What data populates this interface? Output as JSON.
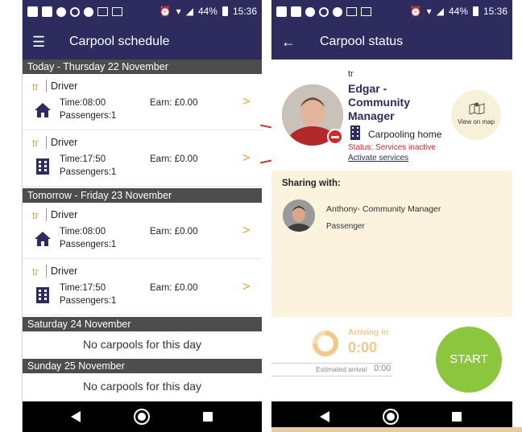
{
  "status_bar": {
    "battery": "44%",
    "time": "15:36"
  },
  "left": {
    "title": "Carpool schedule",
    "menu_icon": "menu-icon",
    "days": [
      {
        "label": "Today - Thursday 22 November"
      },
      {
        "label": "Tomorrow - Friday 23 November"
      },
      {
        "label": "Saturday 24 November"
      },
      {
        "label": "Sunday 25 November"
      }
    ],
    "trips": [
      {
        "tr": "tr",
        "role": "Driver",
        "time": "Time:08:00",
        "passengers": "Passengers:1",
        "earn": "Earn: £0.00",
        "icon": "home-icon"
      },
      {
        "tr": "tr",
        "role": "Driver",
        "time": "Time:17:50",
        "passengers": "Passengers:1",
        "earn": "Earn: £0.00",
        "icon": "building-icon"
      },
      {
        "tr": "tr",
        "role": "Driver",
        "time": "Time:08:00",
        "passengers": "Passengers:1",
        "earn": "Earn: £0.00",
        "icon": "home-icon"
      },
      {
        "tr": "tr",
        "role": "Driver",
        "time": "Time:17:50",
        "passengers": "Passengers:1",
        "earn": "Earn: £0.00",
        "icon": "building-icon"
      }
    ],
    "no_carpools": "No carpools for this day",
    "chevron": ">"
  },
  "right": {
    "title": "Carpool status",
    "back_icon": "←",
    "profile": {
      "tr": "tr",
      "name": "Edgar - Community Manager",
      "place": "Carpooling home",
      "status": "Status: Services inactive",
      "activate": "Activate services"
    },
    "map_label": "View on map",
    "sharing_title": "Sharing with:",
    "passenger": {
      "name": "Anthony- Community Manager",
      "role": "Passenger"
    },
    "arrival": {
      "label": "Arriving in",
      "time": "0:00",
      "estimated_label": "Estimated arrival",
      "estimated_time": "0:00"
    },
    "start_label": "START"
  },
  "colors": {
    "primary": "#2e2b5f",
    "accent": "#e5a33a",
    "start": "#8cc63f",
    "error": "#d3282a",
    "panel": "#fcf3de"
  }
}
